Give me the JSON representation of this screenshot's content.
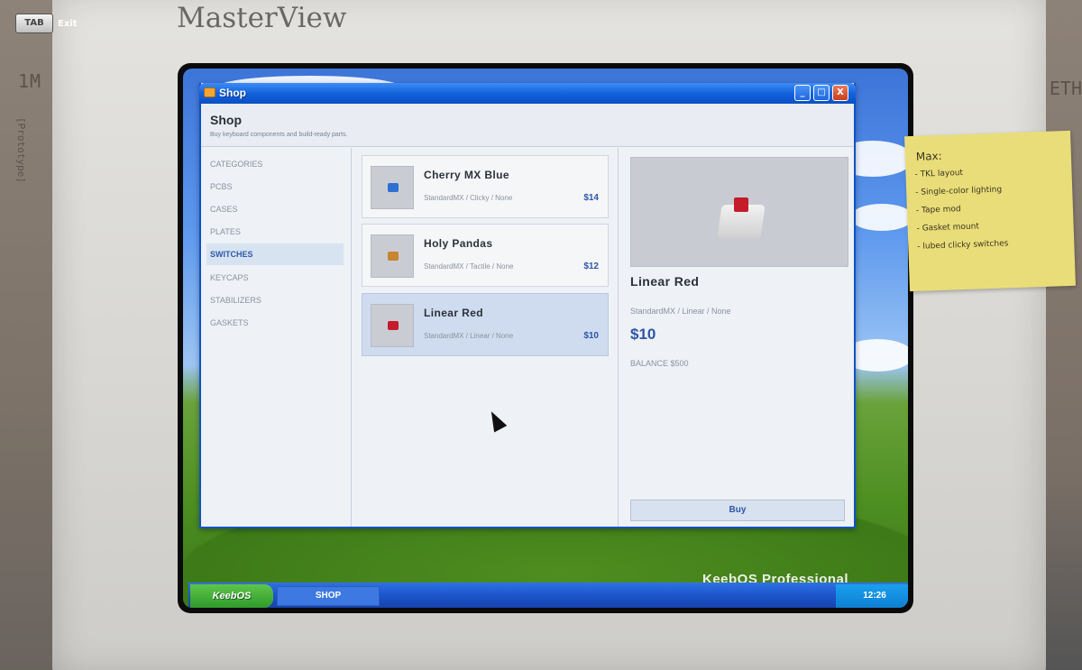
{
  "game": {
    "monitor_brand": "MasterView",
    "tab_key": "TAB",
    "exit_label": "Exit",
    "wall_text_left": "1M",
    "wall_text_left_vertical": "[Prototype]",
    "wall_text_right": "ETH"
  },
  "window": {
    "title": "Shop",
    "controls": {
      "minimize": "_",
      "maximize": "□",
      "close": "X"
    }
  },
  "shop": {
    "heading": "Shop",
    "subtitle": "Buy keyboard components and build-ready parts."
  },
  "sidebar": {
    "header": "CATEGORIES",
    "items": [
      {
        "label": "PCBS",
        "active": false
      },
      {
        "label": "CASES",
        "active": false
      },
      {
        "label": "PLATES",
        "active": false
      },
      {
        "label": "SWITCHES",
        "active": true
      },
      {
        "label": "KEYCAPS",
        "active": false
      },
      {
        "label": "STABILIZERS",
        "active": false
      },
      {
        "label": "GASKETS",
        "active": false
      }
    ]
  },
  "products": [
    {
      "name": "Cherry MX Blue",
      "meta": "StandardMX / Clicky / None",
      "price": "$14",
      "selected": false,
      "color": "#2f6fd1"
    },
    {
      "name": "Holy Pandas",
      "meta": "StandardMX / Tactile / None",
      "price": "$12",
      "selected": false,
      "color": "#c9852f"
    },
    {
      "name": "Linear Red",
      "meta": "StandardMX / Linear / None",
      "price": "$10",
      "selected": true,
      "color": "#c51b2a"
    }
  ],
  "detail": {
    "name": "Linear Red",
    "meta": "StandardMX / Linear / None",
    "price": "$10",
    "balance": "BALANCE $500",
    "buy_label": "Buy"
  },
  "taskbar": {
    "start_label": "KeebOS",
    "task_label": "SHOP",
    "clock": "12:26",
    "watermark": "KeebOS Professional"
  },
  "sticky_note": {
    "title": "Max:",
    "lines": [
      "- TKL layout",
      "- Single-color lighting",
      "- Tape mod",
      "- Gasket mount",
      "- lubed clicky switches"
    ]
  },
  "colors": {
    "accent": "#2d55a8",
    "titlebar": "#1462dc",
    "selected_card": "#cfdcef"
  }
}
